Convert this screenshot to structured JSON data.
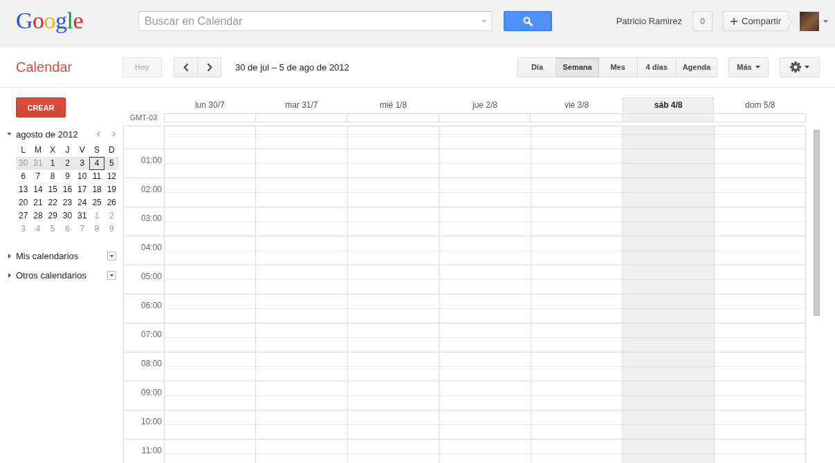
{
  "header": {
    "logo": "Google",
    "search": {
      "placeholder": "Buscar en Calendar"
    },
    "user_name": "Patricio Ramirez",
    "notification_count": "0",
    "share_button": "Compartir"
  },
  "toolbar": {
    "app_title": "Calendar",
    "today_button": {
      "label": "Hoy",
      "disabled": true
    },
    "date_range": "30 de jul – 5 de ago de 2012",
    "views": [
      {
        "label": "Día",
        "selected": false
      },
      {
        "label": "Semana",
        "selected": true
      },
      {
        "label": "Mes",
        "selected": false
      },
      {
        "label": "4 días",
        "selected": false
      },
      {
        "label": "Agenda",
        "selected": false
      }
    ],
    "more_button": "Más"
  },
  "sidebar": {
    "create_button": "CREAR",
    "mini_calendar": {
      "title": "agosto de 2012",
      "expanded": true,
      "weekdays": [
        "L",
        "M",
        "X",
        "J",
        "V",
        "S",
        "D"
      ],
      "weeks": [
        {
          "selected": true,
          "days": [
            {
              "day": "30",
              "other_month": true,
              "today": false
            },
            {
              "day": "31",
              "other_month": true,
              "today": false
            },
            {
              "day": "1",
              "other_month": false,
              "today": false
            },
            {
              "day": "2",
              "other_month": false,
              "today": false
            },
            {
              "day": "3",
              "other_month": false,
              "today": false
            },
            {
              "day": "4",
              "other_month": false,
              "today": true
            },
            {
              "day": "5",
              "other_month": false,
              "today": false
            }
          ]
        },
        {
          "selected": false,
          "days": [
            {
              "day": "6",
              "other_month": false,
              "today": false
            },
            {
              "day": "7",
              "other_month": false,
              "today": false
            },
            {
              "day": "8",
              "other_month": false,
              "today": false
            },
            {
              "day": "9",
              "other_month": false,
              "today": false
            },
            {
              "day": "10",
              "other_month": false,
              "today": false
            },
            {
              "day": "11",
              "other_month": false,
              "today": false
            },
            {
              "day": "12",
              "other_month": false,
              "today": false
            }
          ]
        },
        {
          "selected": false,
          "days": [
            {
              "day": "13",
              "other_month": false,
              "today": false
            },
            {
              "day": "14",
              "other_month": false,
              "today": false
            },
            {
              "day": "15",
              "other_month": false,
              "today": false
            },
            {
              "day": "16",
              "other_month": false,
              "today": false
            },
            {
              "day": "17",
              "other_month": false,
              "today": false
            },
            {
              "day": "18",
              "other_month": false,
              "today": false
            },
            {
              "day": "19",
              "other_month": false,
              "today": false
            }
          ]
        },
        {
          "selected": false,
          "days": [
            {
              "day": "20",
              "other_month": false,
              "today": false
            },
            {
              "day": "21",
              "other_month": false,
              "today": false
            },
            {
              "day": "22",
              "other_month": false,
              "today": false
            },
            {
              "day": "23",
              "other_month": false,
              "today": false
            },
            {
              "day": "24",
              "other_month": false,
              "today": false
            },
            {
              "day": "25",
              "other_month": false,
              "today": false
            },
            {
              "day": "26",
              "other_month": false,
              "today": false
            }
          ]
        },
        {
          "selected": false,
          "days": [
            {
              "day": "27",
              "other_month": false,
              "today": false
            },
            {
              "day": "28",
              "other_month": false,
              "today": false
            },
            {
              "day": "29",
              "other_month": false,
              "today": false
            },
            {
              "day": "30",
              "other_month": false,
              "today": false
            },
            {
              "day": "31",
              "other_month": false,
              "today": false
            },
            {
              "day": "1",
              "other_month": true,
              "today": false
            },
            {
              "day": "2",
              "other_month": true,
              "today": false
            }
          ]
        },
        {
          "selected": false,
          "days": [
            {
              "day": "3",
              "other_month": true,
              "today": false
            },
            {
              "day": "4",
              "other_month": true,
              "today": false
            },
            {
              "day": "5",
              "other_month": true,
              "today": false
            },
            {
              "day": "6",
              "other_month": true,
              "today": false
            },
            {
              "day": "7",
              "other_month": true,
              "today": false
            },
            {
              "day": "8",
              "other_month": true,
              "today": false
            },
            {
              "day": "9",
              "other_month": true,
              "today": false
            }
          ]
        }
      ]
    },
    "calendar_lists": [
      {
        "label": "Mis calendarios",
        "expanded": false
      },
      {
        "label": "Otros calendarios",
        "expanded": false
      }
    ]
  },
  "week_view": {
    "timezone": "GMT-03",
    "days": [
      {
        "label": "lun 30/7",
        "today": false
      },
      {
        "label": "mar 31/7",
        "today": false
      },
      {
        "label": "mié 1/8",
        "today": false
      },
      {
        "label": "jue 2/8",
        "today": false
      },
      {
        "label": "vie 3/8",
        "today": false
      },
      {
        "label": "sáb 4/8",
        "today": true
      },
      {
        "label": "dom 5/8",
        "today": false
      }
    ],
    "hours": [
      "01:00",
      "02:00",
      "03:00",
      "04:00",
      "05:00",
      "06:00",
      "07:00",
      "08:00",
      "09:00",
      "10:00",
      "11:00"
    ]
  }
}
